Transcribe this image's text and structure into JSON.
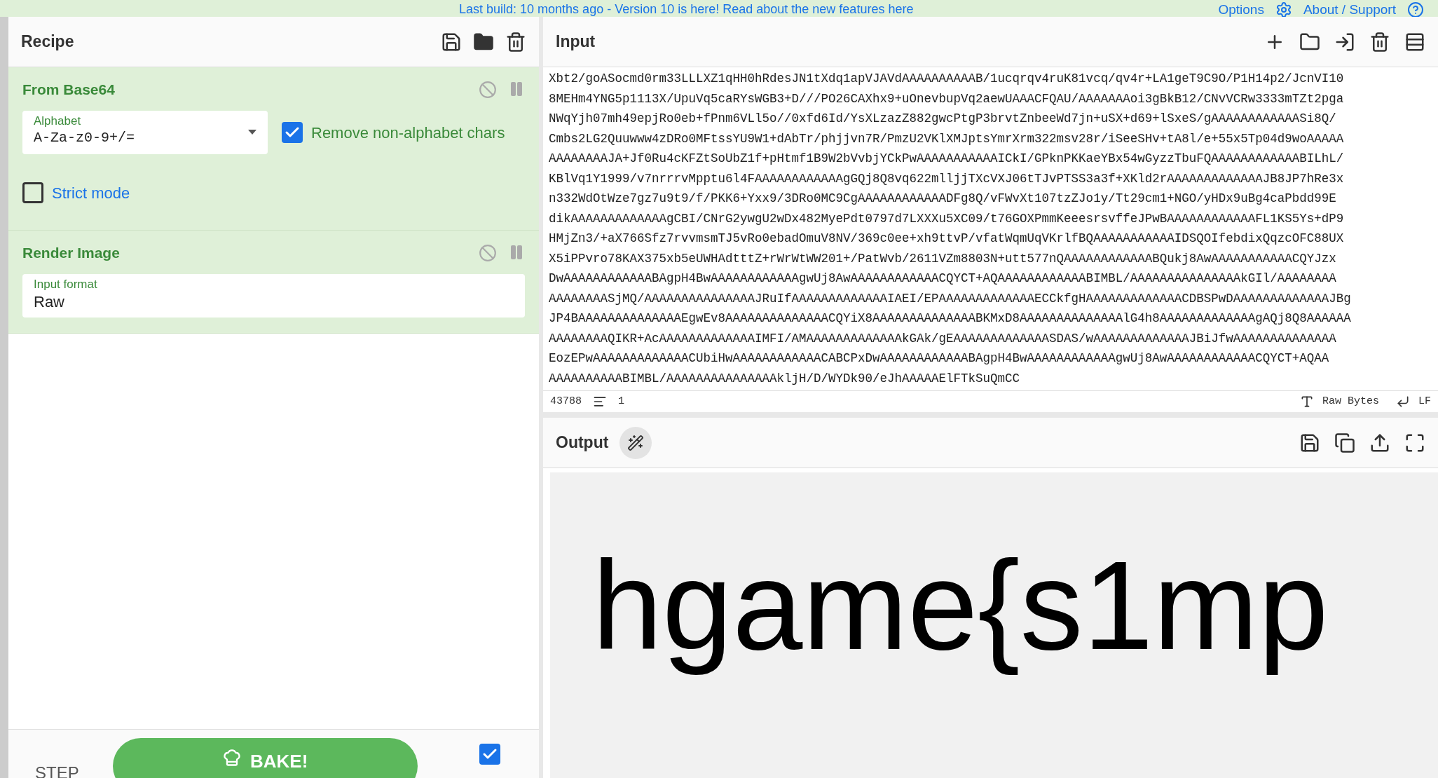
{
  "banner": {
    "text": "Last build: 10 months ago - Version 10 is here! Read about the new features here",
    "options": "Options",
    "about": "About / Support"
  },
  "recipe": {
    "title": "Recipe",
    "operations": [
      {
        "name": "From Base64",
        "disabled": false,
        "args": [
          {
            "kind": "select",
            "label": "Alphabet",
            "value": "A-Za-z0-9+/="
          },
          {
            "kind": "checkbox",
            "label": "Remove non-alphabet chars",
            "checked": true
          },
          {
            "kind": "checkbox",
            "label": "Strict mode",
            "checked": false
          }
        ]
      },
      {
        "name": "Render Image",
        "disabled": false,
        "args": [
          {
            "kind": "field",
            "label": "Input format",
            "value": "Raw"
          }
        ]
      }
    ]
  },
  "controls": {
    "step": "STEP",
    "bake": "BAKE!",
    "auto_bake": true
  },
  "input": {
    "title": "Input",
    "lines": [
      "Xbt2/goASocmd0rm33LLLXZ1qHH0hRdesJN1tXdq1apVJAVdAAAAAAAAAAB/1ucqrqv4ruK81vcq/qv4r+LA1geT9C9O/P1H14p2/JcnVI10",
      "8MEHm4YNG5p1113X/UpuVq5caRYsWGB3+D///PO26CAXhx9+uOnevbupVq2aewUAAACFQAU/AAAAAAAoi3gBkB12/CNvVCRw3333mTZt2pga",
      "NWqYjh07mh49epjRo0eb+fPnm6VLl5o//0xfd6Id/YsXLzazZ882gwcPtgP3brvtZnbeeWd7jn+uSX+d69+lSxeS/gAAAAAAAAAAAASi8Q/",
      "Cmbs2LG2Quuwww4zDRo0MFtssYU9W1+dAbTr/phjjvn7R/PmzU2VKlXMJptsYmrXrm322msv28r/iSeeSHv+tA8l/e+55x5Tp04d9woAAAAA",
      "AAAAAAAAJA+Jf0Ru4cKFZtSoUbZ1f+pHtmf1B9W2bVvbjYCkPwAAAAAAAAAAAICkI/GPknPKKaeYBx54wGyzzTbuFQAAAAAAAAAAAABILhL/",
      "KBlVq1Y1999/v7nrrrvMpptu6l4FAAAAAAAAAAAAgGQj8Q8vq622mlljjTXcVXJ06tTJvPTSS3a3f+XKld2rAAAAAAAAAAAAAJB8JP7hRe3x",
      "n332WdOtWze7gz7u9t9/f/PKK6+Yxx9/3DRo0MC9CgAAAAAAAAAAAADFg8Q/vFWvXt107tzZJo1y/Tt29cm1+NGO/yHDx9uBg4caPbdd99E",
      "dikAAAAAAAAAAAAAgCBI/CNrG2ywgU2wDx482MyePdt0797d7LXXXu5XC09/t76GOXPmmKeeesrsvffeJPwBAAAAAAAAAAAAFL1KS5Ys+dP9",
      "HMjZn3/+aX766Sfz7rvvmsmTJ5vRo0ebadOmuV8NV/369c0ee+xh9ttvP/vfatWqmUqVKrlfBQAAAAAAAAAAAIDSQOIfebdixQqzcOFC88UX",
      "X5iPPvro78KAX375xb5eUWHAdtttZ+rWrWtWW201+/PatWvb/2611VZm8803N+utt577nQAAAAAAAAAAAABQukj8AwAAAAAAAAAAACQYJzx",
      "DwAAAAAAAAAAAABAgpH4BwAAAAAAAAAAAAgwUj8AwAAAAAAAAAAAACQYCT+AQAAAAAAAAAAAABIMBL/AAAAAAAAAAAAAAAkGIl/AAAAAAAA",
      "AAAAAAAASjMQ/AAAAAAAAAAAAAAAJRuIfAAAAAAAAAAAAAIAEI/EPAAAAAAAAAAAAAECCkfgHAAAAAAAAAAAAACDBSPwDAAAAAAAAAAAAAJBg",
      "JP4BAAAAAAAAAAAAAAEgwEv8AAAAAAAAAAAAAACQYiX8AAAAAAAAAAAAAABKMxD8AAAAAAAAAAAAAAlG4h8AAAAAAAAAAAAAgAQj8Q8AAAAAA",
      "AAAAAAAAQIKR+AcAAAAAAAAAAAAAIMFI/AMAAAAAAAAAAAAAkGAk/gEAAAAAAAAAAAAASDAS/wAAAAAAAAAAAAAJBiJfwAAAAAAAAAAAAAA",
      "EozEPwAAAAAAAAAAAAACUbiHwAAAAAAAAAAAACABCPxDwAAAAAAAAAAAABAgpH4BwAAAAAAAAAAAAgwUj8AwAAAAAAAAAAAACQYCT+AQAA",
      "AAAAAAAAAABIMBL/AAAAAAAAAAAAAAAkljH/D/WYDk90/eJhAAAAAElFTkSuQmCC"
    ],
    "length": "43788",
    "line_count": "1",
    "format": "Raw Bytes",
    "eol": "LF"
  },
  "output": {
    "title": "Output",
    "image_text": "hgame{s1mp"
  }
}
